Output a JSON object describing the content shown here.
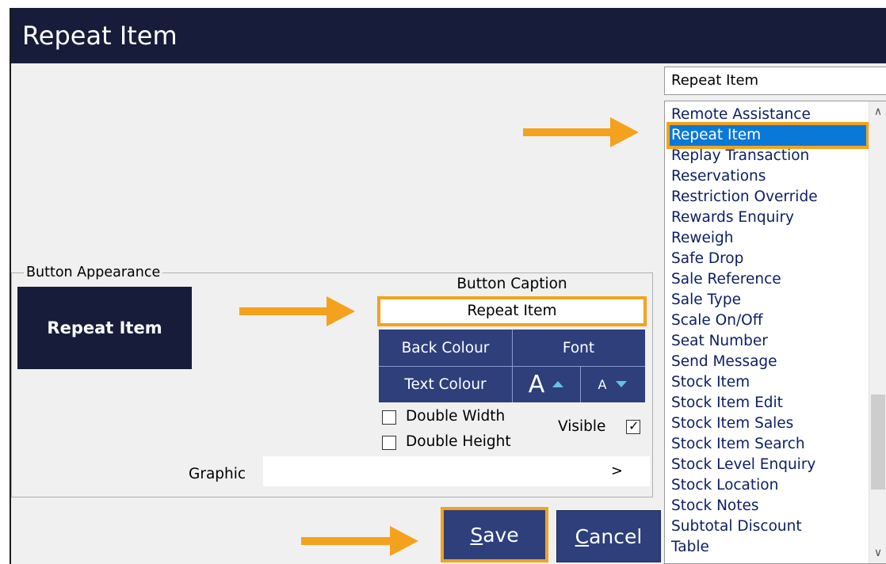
{
  "window": {
    "title": "Repeat Item"
  },
  "function_search": {
    "value": "Repeat Item"
  },
  "function_list": {
    "items": [
      "Remote Assistance",
      "Repeat Item",
      "Replay Transaction",
      "Reservations",
      "Restriction Override",
      "Rewards Enquiry",
      "Reweigh",
      "Safe Drop",
      "Sale Reference",
      "Sale Type",
      "Scale On/Off",
      "Seat Number",
      "Send Message",
      "Stock Item",
      "Stock Item Edit",
      "Stock Item Sales",
      "Stock Item Search",
      "Stock Level Enquiry",
      "Stock Location",
      "Stock Notes",
      "Subtotal Discount",
      "Table"
    ],
    "selected": "Repeat Item"
  },
  "appearance": {
    "legend": "Button Appearance",
    "preview_label": "Repeat Item",
    "caption_label": "Button Caption",
    "caption_value": "Repeat Item",
    "back_colour": "Back Colour",
    "font": "Font",
    "text_colour": "Text Colour",
    "font_large_glyph": "A",
    "font_small_glyph": "A",
    "double_width": "Double Width",
    "double_height": "Double Height",
    "visible": "Visible",
    "visible_checked": true,
    "graphic_label": "Graphic",
    "graphic_arrow": ">"
  },
  "actions": {
    "save_prefix": "S",
    "save_rest": "ave",
    "cancel_prefix": "C",
    "cancel_rest": "ancel"
  },
  "colors": {
    "title_bar": "#161c3a",
    "button_bg": "#2e3f7c",
    "highlight": "#f4a21d",
    "selection": "#0a78d7"
  }
}
